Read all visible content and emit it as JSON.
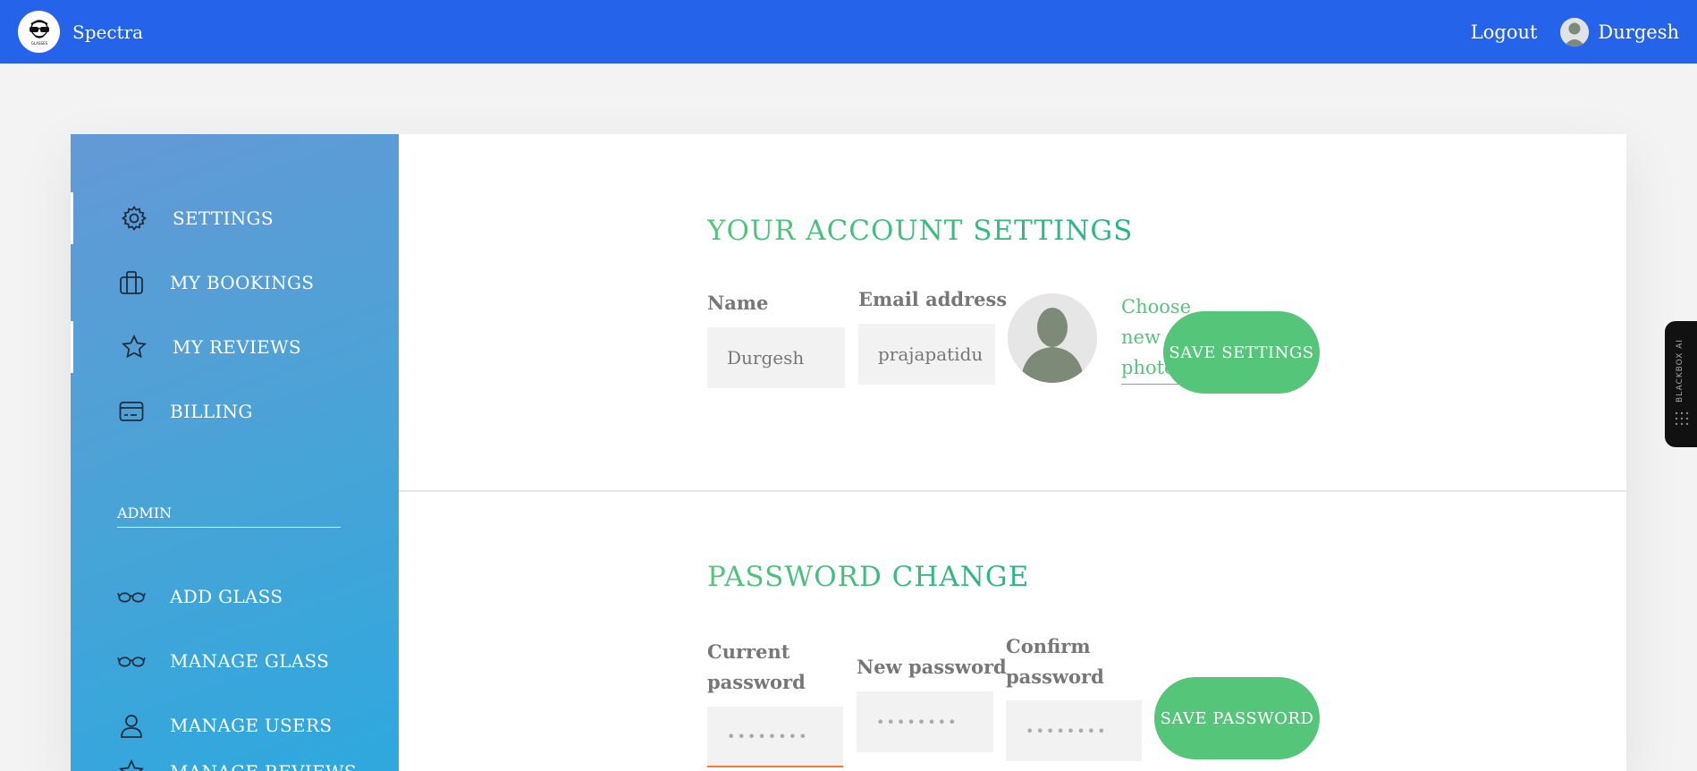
{
  "header": {
    "brand": "Spectra",
    "logout": "Logout",
    "user_name": "Durgesh"
  },
  "sidebar": {
    "items": [
      {
        "label": "SETTINGS",
        "icon": "gear-icon"
      },
      {
        "label": "MY BOOKINGS",
        "icon": "briefcase-icon"
      },
      {
        "label": "MY REVIEWS",
        "icon": "star-icon"
      },
      {
        "label": "BILLING",
        "icon": "credit-card-icon"
      }
    ],
    "admin_label": "ADMIN",
    "admin_items": [
      {
        "label": "ADD GLASS",
        "icon": "glasses-icon"
      },
      {
        "label": "MANAGE GLASS",
        "icon": "glasses-icon"
      },
      {
        "label": "MANAGE USERS",
        "icon": "user-icon"
      },
      {
        "label": "MANAGE REVIEWS",
        "icon": "star-icon"
      }
    ]
  },
  "account": {
    "title": "YOUR ACCOUNT SETTINGS",
    "name_label": "Name",
    "name_value": "Durgesh",
    "email_label": "Email address",
    "email_value": "prajapatidu",
    "choose_photo": "Choose new photo",
    "save_button": "SAVE SETTINGS"
  },
  "password": {
    "title": "PASSWORD CHANGE",
    "current_label": "Current password",
    "new_label": "New password",
    "confirm_label": "Confirm password",
    "placeholder": "••••••••",
    "save_button": "SAVE PASSWORD"
  },
  "side_tab": {
    "label": "BLACKBOX AI"
  },
  "colors": {
    "header": "#2563eb",
    "accent_green": "#55c57a",
    "focus_orange": "#ff7730"
  }
}
